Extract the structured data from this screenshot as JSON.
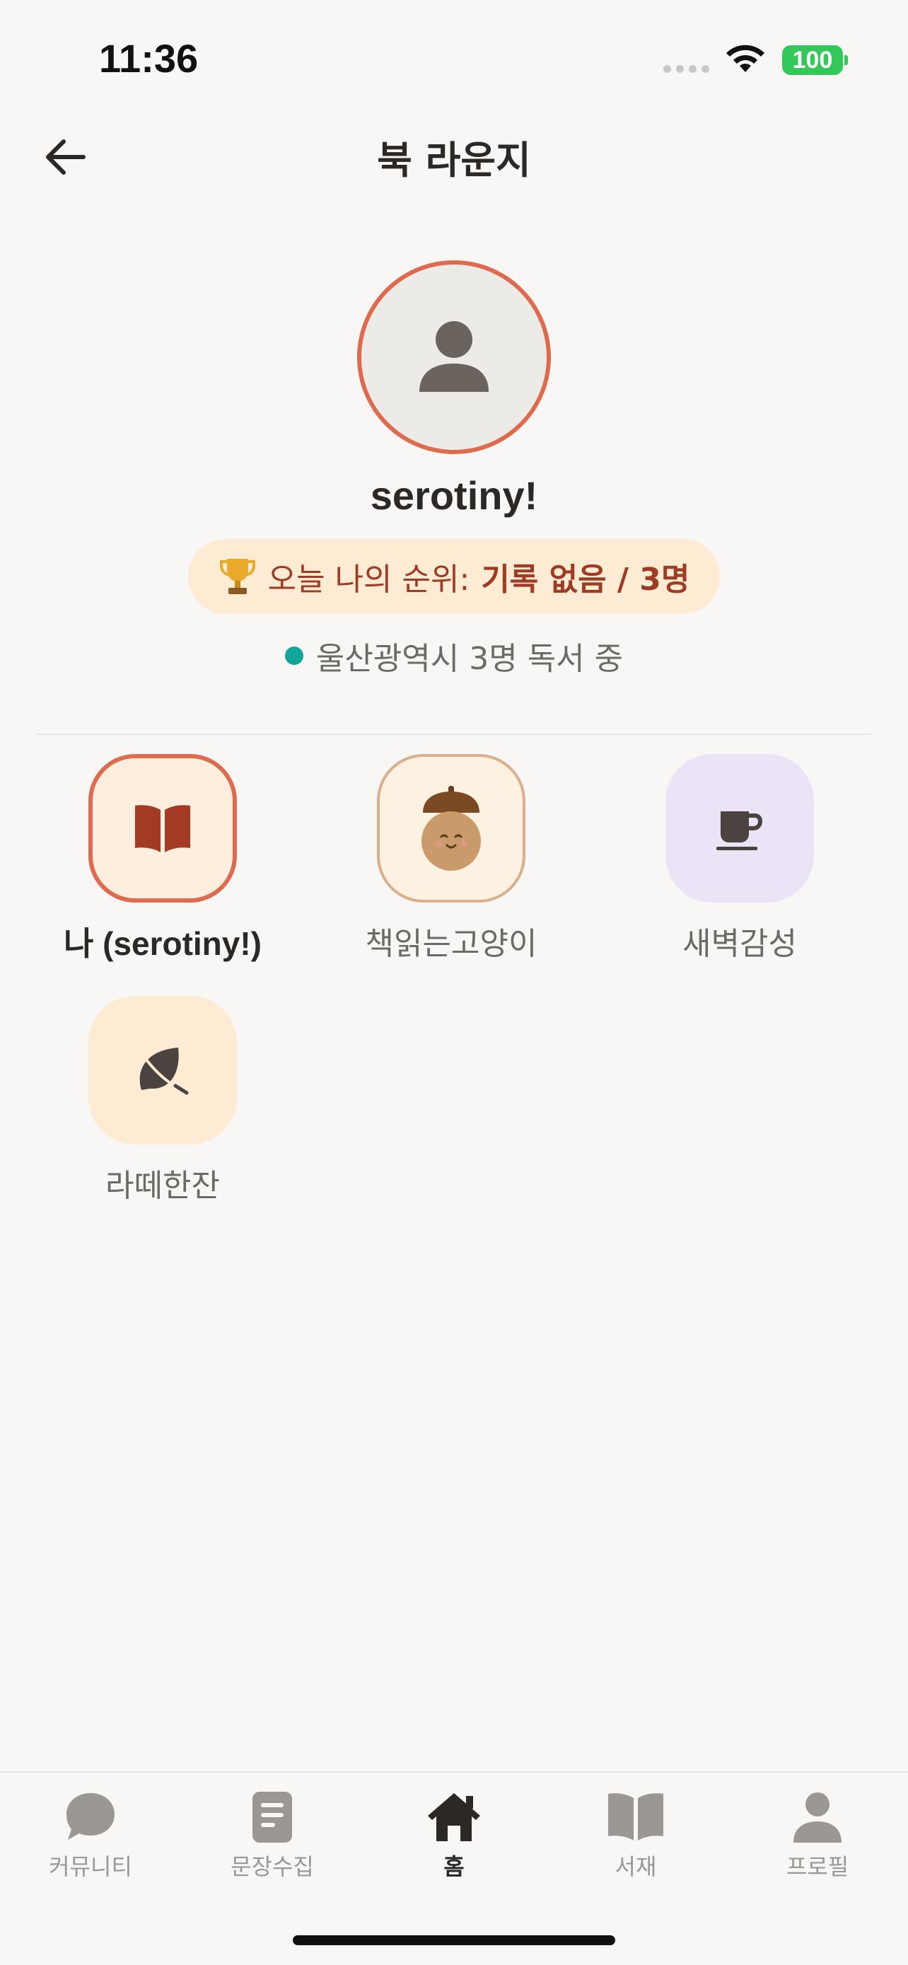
{
  "status_bar": {
    "time": "11:36",
    "battery": "100"
  },
  "header": {
    "title": "북 라운지",
    "back_icon": "arrow-left-icon"
  },
  "profile": {
    "username": "serotiny!",
    "rank": {
      "icon": "trophy-icon",
      "label": "오늘 나의 순위:",
      "value": "기록 없음 / 3명"
    },
    "reading_status": "울산광역시 3명 독서 중",
    "status_color": "#12a59a",
    "accent_color": "#df6b4e"
  },
  "members": [
    {
      "name": "나 (serotiny!)",
      "icon": "open-book-icon",
      "is_me": true
    },
    {
      "name": "책읽는고양이",
      "icon": "acorn-character-icon",
      "is_me": false
    },
    {
      "name": "새벽감성",
      "icon": "coffee-cup-icon",
      "is_me": false
    },
    {
      "name": "라떼한잔",
      "icon": "leaf-icon",
      "is_me": false
    }
  ],
  "bottom_nav": {
    "items": [
      {
        "label": "커뮤니티",
        "icon": "chat-bubble-icon",
        "active": false
      },
      {
        "label": "문장수집",
        "icon": "note-icon",
        "active": false
      },
      {
        "label": "홈",
        "icon": "home-icon",
        "active": true
      },
      {
        "label": "서재",
        "icon": "book-icon",
        "active": false
      },
      {
        "label": "프로필",
        "icon": "person-icon",
        "active": false
      }
    ]
  }
}
